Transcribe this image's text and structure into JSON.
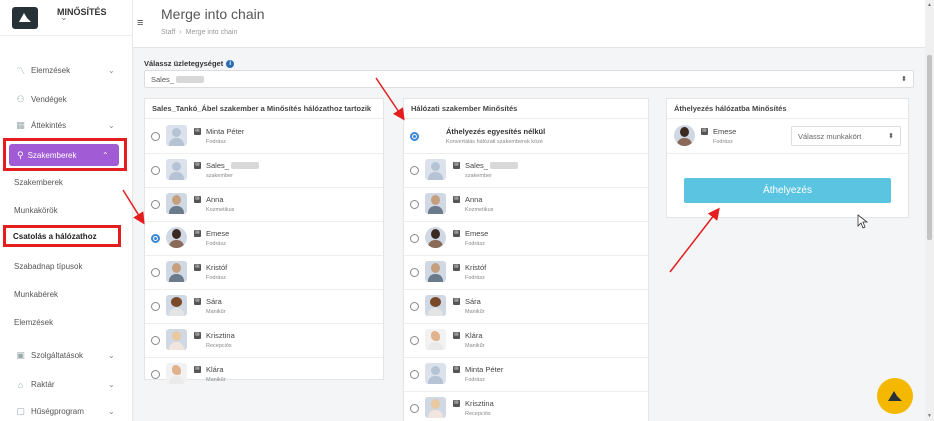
{
  "brand": {
    "name": "MINŐSÍTÉS"
  },
  "sidebar": {
    "items": [
      {
        "label": "Elemzések",
        "icon": "chart-icon"
      },
      {
        "label": "Vendégek",
        "icon": "users-icon"
      },
      {
        "label": "Áttekintés",
        "icon": "grid-icon"
      },
      {
        "label": "Szakemberek",
        "icon": "person-icon"
      },
      {
        "label": "Szolgáltatások",
        "icon": "services-icon"
      },
      {
        "label": "Raktár",
        "icon": "warehouse-icon"
      },
      {
        "label": "Hűségprogram",
        "icon": "loyalty-icon"
      }
    ],
    "sub_items": [
      "Szakemberek",
      "Munkakörök",
      "Csatolás a hálózathoz",
      "Szabadnap típusok",
      "Munkabérek",
      "Elemzések"
    ]
  },
  "header": {
    "title": "Merge into chain",
    "breadcrumb": [
      "Staff",
      "Merge into chain"
    ]
  },
  "store": {
    "label": "Válassz üzletegységet",
    "value": "Sales_"
  },
  "left_panel": {
    "title": "Sales_Tankó_Ábel szakember a Minősítés hálózathoz tartozik",
    "rows": [
      {
        "name": "Minta Péter",
        "role": "Fodrász"
      },
      {
        "name": "Sales_",
        "role": "szakember"
      },
      {
        "name": "Anna",
        "role": "Kozmetikus"
      },
      {
        "name": "Emese",
        "role": "Fodrász"
      },
      {
        "name": "Kristóf",
        "role": "Fodrász"
      },
      {
        "name": "Sára",
        "role": "Manikűr"
      },
      {
        "name": "Krisztina",
        "role": "Recepciós"
      },
      {
        "name": "Klára",
        "role": "Manikűr"
      }
    ]
  },
  "middle_panel": {
    "title": "Hálózati szakember Minősítés",
    "first_option": {
      "name": "Áthelyezés egyesítés nélkül",
      "sub": "Konvertálás hálózati szakemberek közé"
    },
    "rows": [
      {
        "name": "Sales_",
        "role": "szakember"
      },
      {
        "name": "Anna",
        "role": "Kozmetikus"
      },
      {
        "name": "Emese",
        "role": "Fodrász"
      },
      {
        "name": "Kristóf",
        "role": "Fodrász"
      },
      {
        "name": "Sára",
        "role": "Manikűr"
      },
      {
        "name": "Klára",
        "role": "Manikűr"
      },
      {
        "name": "Minta Péter",
        "role": "Fodrász"
      },
      {
        "name": "Krisztina",
        "role": "Recepciós"
      }
    ]
  },
  "right_panel": {
    "title": "Áthelyezés hálózatba Minősítés",
    "person": {
      "name": "Emese",
      "role": "Fodrász"
    },
    "role_select_placeholder": "Válassz munkakört",
    "button_label": "Áthelyezés"
  },
  "colors": {
    "accent": "#a05bd5",
    "button": "#5bc4e0",
    "annotation": "#e41e1e",
    "fab": "#f5b800"
  }
}
